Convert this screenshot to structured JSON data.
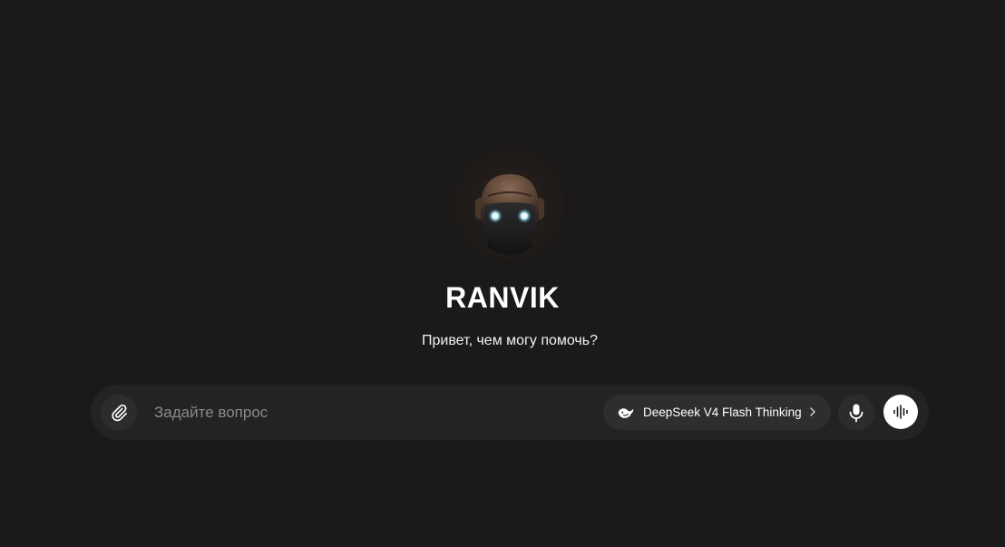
{
  "assistant": {
    "name": "RANVIK",
    "greeting": "Привет, чем могу помочь?"
  },
  "composer": {
    "placeholder": "Задайте вопрос",
    "value": "",
    "model_label": "DeepSeek V4 Flash Thinking"
  },
  "icons": {
    "attach": "paperclip-icon",
    "model": "whale-icon",
    "chevron": "chevron-right-icon",
    "mic": "microphone-icon",
    "voice": "voice-wave-icon"
  },
  "colors": {
    "background": "#1a1a1a",
    "composer_bg": "#232323",
    "button_bg": "#2c2c2c",
    "pill_bg": "#2e2e2e",
    "voice_button_bg": "#ffffff",
    "eye_glow": "#9fe3ff"
  }
}
